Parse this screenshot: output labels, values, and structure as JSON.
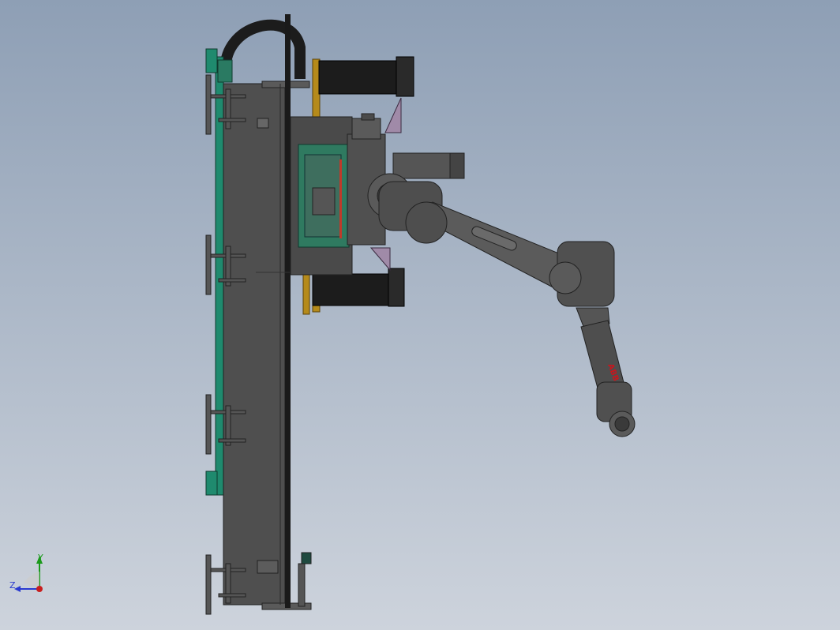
{
  "viewport": {
    "background_top": "#8e9fb5",
    "background_bottom": "#cdd3dc"
  },
  "robot": {
    "brand_label": "ABB",
    "brand_color": "#c8161d",
    "body_color": "#4e4e4e",
    "shade_color": "#3a3a3a",
    "light_color": "#6a6a6a"
  },
  "gantry": {
    "beam_color": "#4f4f4f",
    "rail_color": "#1f8a6e",
    "track_color": "#1a1a1a",
    "bracket_color": "#b58a1a",
    "plate_color": "#2f7a60",
    "panel_color": "#a08aa8"
  },
  "triad": {
    "y_label": "Y",
    "z_label": "Z",
    "y_color": "#1a9a1a",
    "z_color": "#2a3ad0",
    "x_color": "#c81e1e"
  }
}
